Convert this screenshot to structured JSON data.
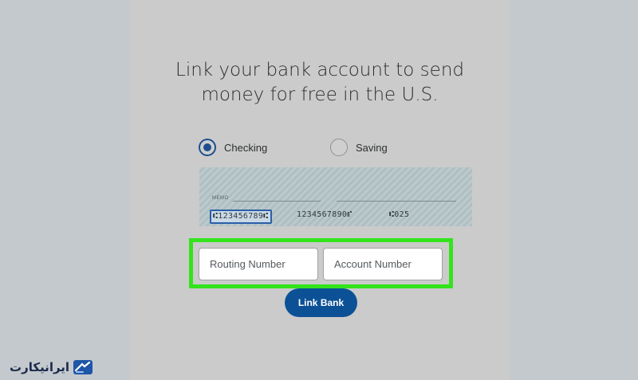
{
  "title": "Link your bank account to send money for free in the U.S.",
  "account_type": {
    "options": [
      {
        "label": "Checking",
        "selected": true
      },
      {
        "label": "Saving",
        "selected": false
      }
    ]
  },
  "check_image": {
    "memo_label": "MEMO",
    "routing_micr": "⑆123456789⑆",
    "account_micr": "1234567890⑈",
    "check_number_micr": "⑆025"
  },
  "form": {
    "routing_placeholder": "Routing Number",
    "account_placeholder": "Account Number"
  },
  "link_button_label": "Link Bank",
  "watermark": "ایرانیکارت",
  "colors": {
    "highlight": "#33e31c",
    "primary_button": "#0c5195",
    "radio_selected": "#1f4f8e"
  }
}
